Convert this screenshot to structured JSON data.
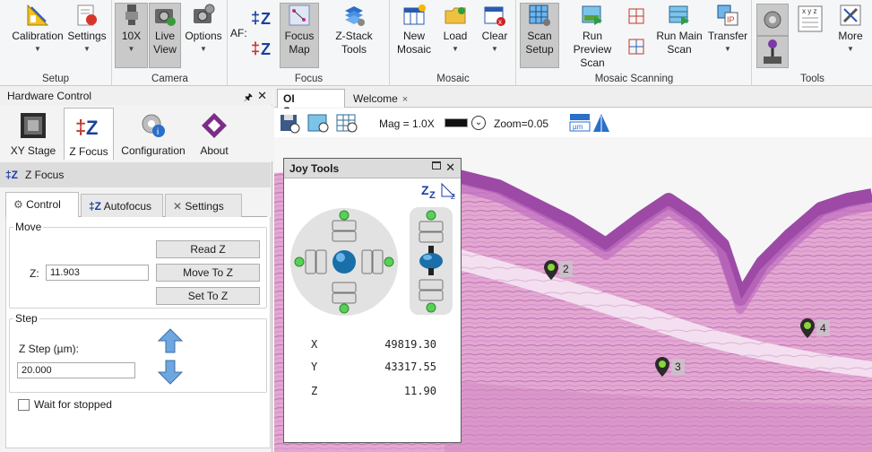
{
  "ribbon": {
    "groups": {
      "setup": "Setup",
      "camera": "Camera",
      "focus": "Focus",
      "mosaic": "Mosaic",
      "mosaic_scanning": "Mosaic Scanning",
      "tools": "Tools"
    },
    "buttons": {
      "calibration": "Calibration",
      "settings": "Settings",
      "objective": "10X",
      "live_view_1": "Live",
      "live_view_2": "View",
      "options": "Options",
      "af_label": "AF:",
      "focus_map_1": "Focus",
      "focus_map_2": "Map",
      "zstack_tools": "Z-Stack Tools",
      "new_mosaic_1": "New",
      "new_mosaic_2": "Mosaic",
      "load": "Load",
      "clear": "Clear",
      "scan_setup_1": "Scan",
      "scan_setup_2": "Setup",
      "run_preview_1": "Run Preview",
      "run_preview_2": "Scan",
      "run_main_1": "Run Main",
      "run_main_2": "Scan",
      "transfer": "Transfer",
      "more": "More",
      "xyz_label": "x y z"
    }
  },
  "left_panel": {
    "title": "Hardware Control",
    "tabs": [
      "XY Stage",
      "Z Focus",
      "Configuration",
      "About"
    ],
    "section_title": "Z Focus",
    "subtabs": [
      "Control",
      "Autofocus",
      "Settings"
    ],
    "move": {
      "legend": "Move",
      "z_label": "Z:",
      "z_value": "11.903",
      "read_z": "Read Z",
      "move_to_z": "Move To Z",
      "set_to_z": "Set To Z"
    },
    "step": {
      "legend": "Step",
      "zstep_label": "Z Step (µm):",
      "zstep_value": "20.000"
    },
    "wait_label": "Wait for stopped"
  },
  "documents": {
    "tabs": [
      {
        "label": "OI Scanner",
        "close": "×"
      },
      {
        "label": "Welcome",
        "close": "×"
      }
    ]
  },
  "viewer": {
    "mag": "Mag = 1.0X",
    "zoom": "Zoom=0.05",
    "markers": [
      "2",
      "3",
      "4"
    ]
  },
  "joy_tools": {
    "title": "Joy Tools",
    "coords": [
      {
        "axis": "X",
        "value": "49819.30"
      },
      {
        "axis": "Y",
        "value": "43317.55"
      },
      {
        "axis": "Z",
        "value": "11.90"
      }
    ]
  },
  "colors": {
    "accent": "#1a3fa0",
    "tissue_pink": "#e8b2d6",
    "tissue_purple": "#9c4aa6",
    "marker_green": "#5a9e2f"
  }
}
